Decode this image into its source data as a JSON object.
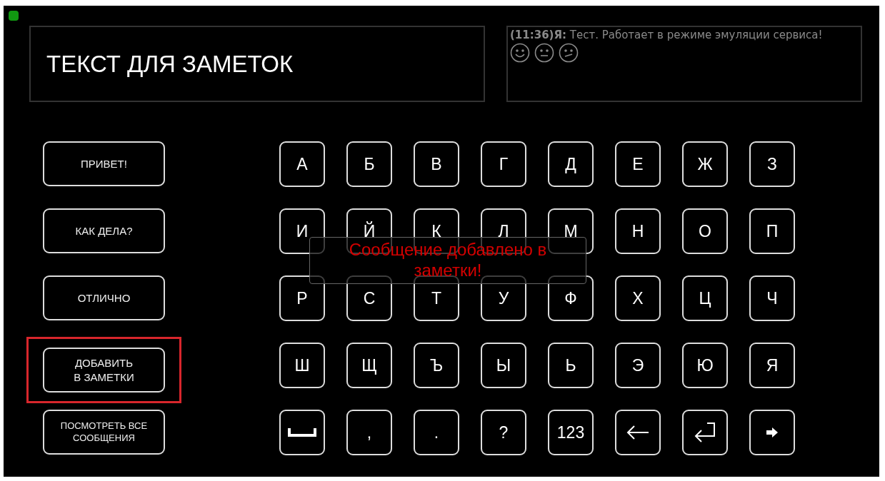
{
  "notes": {
    "text": "ТЕКСТ ДЛЯ ЗАМЕТОК"
  },
  "chat": {
    "message": "**(11:36)Я:** Тест. Работает в режиме эмуляции сервиса!"
  },
  "phrases": [
    {
      "label": "ПРИВЕТ!",
      "highlighted": false
    },
    {
      "label": "КАК ДЕЛА?",
      "highlighted": false
    },
    {
      "label": "ОТЛИЧНО",
      "highlighted": false
    },
    {
      "label": "ДОБАВИТЬ\nВ ЗАМЕТКИ",
      "highlighted": true
    },
    {
      "label": "ПОСМОТРЕТЬ ВСЕ\nСООБЩЕНИЯ",
      "highlighted": false,
      "small": true
    }
  ],
  "keys": [
    {
      "kind": "char",
      "label": "А"
    },
    {
      "kind": "char",
      "label": "Б"
    },
    {
      "kind": "char",
      "label": "В"
    },
    {
      "kind": "char",
      "label": "Г"
    },
    {
      "kind": "char",
      "label": "Д"
    },
    {
      "kind": "char",
      "label": "Е"
    },
    {
      "kind": "char",
      "label": "Ж"
    },
    {
      "kind": "char",
      "label": "З"
    },
    {
      "kind": "char",
      "label": "И"
    },
    {
      "kind": "char",
      "label": "Й"
    },
    {
      "kind": "char",
      "label": "К"
    },
    {
      "kind": "char",
      "label": "Л"
    },
    {
      "kind": "char",
      "label": "М"
    },
    {
      "kind": "char",
      "label": "Н"
    },
    {
      "kind": "char",
      "label": "О"
    },
    {
      "kind": "char",
      "label": "П"
    },
    {
      "kind": "char",
      "label": "Р"
    },
    {
      "kind": "char",
      "label": "С"
    },
    {
      "kind": "char",
      "label": "Т"
    },
    {
      "kind": "char",
      "label": "У"
    },
    {
      "kind": "char",
      "label": "Ф"
    },
    {
      "kind": "char",
      "label": "Х"
    },
    {
      "kind": "char",
      "label": "Ц"
    },
    {
      "kind": "char",
      "label": "Ч"
    },
    {
      "kind": "char",
      "label": "Ш"
    },
    {
      "kind": "char",
      "label": "Щ"
    },
    {
      "kind": "char",
      "label": "Ъ"
    },
    {
      "kind": "char",
      "label": "Ы"
    },
    {
      "kind": "char",
      "label": "Ь"
    },
    {
      "kind": "char",
      "label": "Э"
    },
    {
      "kind": "char",
      "label": "Ю"
    },
    {
      "kind": "char",
      "label": "Я"
    },
    {
      "kind": "space"
    },
    {
      "kind": "char",
      "label": ","
    },
    {
      "kind": "char",
      "label": "."
    },
    {
      "kind": "char",
      "label": "?"
    },
    {
      "kind": "char",
      "label": "123"
    },
    {
      "kind": "backspace"
    },
    {
      "kind": "enter"
    },
    {
      "kind": "next"
    }
  ],
  "toast": {
    "text": "Сообщение добавлено в заметки!"
  }
}
